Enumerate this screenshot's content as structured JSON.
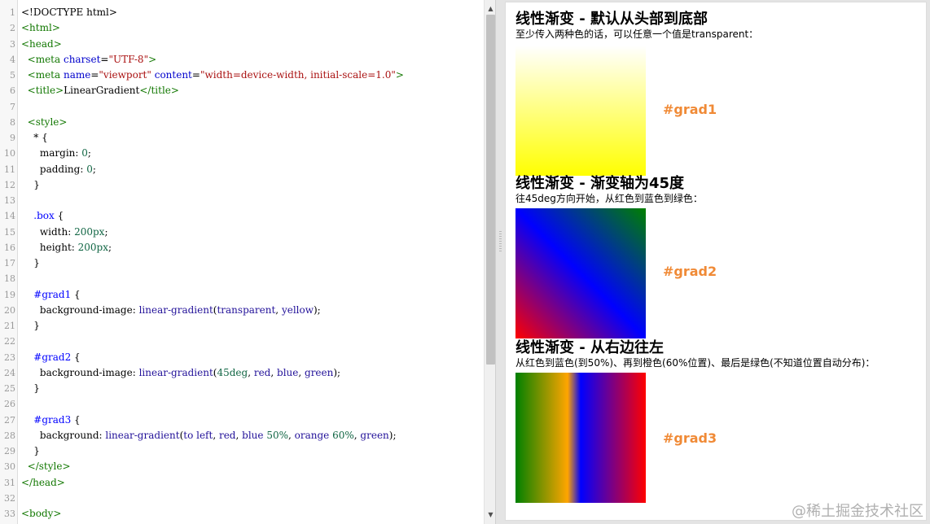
{
  "editor": {
    "lines": [
      [
        [
          "",
          "<!DOCTYPE html>"
        ]
      ],
      [
        [
          "tag",
          "<html>"
        ]
      ],
      [
        [
          "tag",
          "<head>"
        ]
      ],
      [
        [
          "",
          "  "
        ],
        [
          "tag",
          "<meta "
        ],
        [
          "attr",
          "charset"
        ],
        [
          "",
          "="
        ],
        [
          "str",
          "\"UTF-8\""
        ],
        [
          "tag",
          ">"
        ]
      ],
      [
        [
          "",
          "  "
        ],
        [
          "tag",
          "<meta "
        ],
        [
          "attr",
          "name"
        ],
        [
          "",
          "="
        ],
        [
          "str",
          "\"viewport\""
        ],
        [
          "",
          " "
        ],
        [
          "attr",
          "content"
        ],
        [
          "",
          "="
        ],
        [
          "str",
          "\"width=device-width, initial-scale=1.0\""
        ],
        [
          "tag",
          ">"
        ]
      ],
      [
        [
          "",
          "  "
        ],
        [
          "tag",
          "<title>"
        ],
        [
          "",
          "LinearGradient"
        ],
        [
          "tag",
          "</title>"
        ]
      ],
      [
        [
          "",
          ""
        ]
      ],
      [
        [
          "",
          "  "
        ],
        [
          "tag",
          "<style>"
        ]
      ],
      [
        [
          "",
          "    * {"
        ]
      ],
      [
        [
          "",
          "      "
        ],
        [
          "prop",
          "margin"
        ],
        [
          "",
          ": "
        ],
        [
          "num",
          "0"
        ],
        [
          "",
          ";"
        ]
      ],
      [
        [
          "",
          "      "
        ],
        [
          "prop",
          "padding"
        ],
        [
          "",
          ": "
        ],
        [
          "num",
          "0"
        ],
        [
          "",
          ";"
        ]
      ],
      [
        [
          "",
          "    }"
        ]
      ],
      [
        [
          "",
          ""
        ]
      ],
      [
        [
          "",
          "    "
        ],
        [
          "sel",
          ".box"
        ],
        [
          "",
          " {"
        ]
      ],
      [
        [
          "",
          "      "
        ],
        [
          "prop",
          "width"
        ],
        [
          "",
          ": "
        ],
        [
          "num",
          "200px"
        ],
        [
          "",
          ";"
        ]
      ],
      [
        [
          "",
          "      "
        ],
        [
          "prop",
          "height"
        ],
        [
          "",
          ": "
        ],
        [
          "num",
          "200px"
        ],
        [
          "",
          ";"
        ]
      ],
      [
        [
          "",
          "    }"
        ]
      ],
      [
        [
          "",
          ""
        ]
      ],
      [
        [
          "",
          "    "
        ],
        [
          "sel",
          "#grad1"
        ],
        [
          "",
          " {"
        ]
      ],
      [
        [
          "",
          "      "
        ],
        [
          "prop",
          "background-image"
        ],
        [
          "",
          ": "
        ],
        [
          "val",
          "linear-gradient"
        ],
        [
          "",
          "("
        ],
        [
          "val",
          "transparent"
        ],
        [
          "",
          ", "
        ],
        [
          "val",
          "yellow"
        ],
        [
          "",
          ");"
        ]
      ],
      [
        [
          "",
          "    }"
        ]
      ],
      [
        [
          "",
          ""
        ]
      ],
      [
        [
          "",
          "    "
        ],
        [
          "sel",
          "#grad2"
        ],
        [
          "",
          " {"
        ]
      ],
      [
        [
          "",
          "      "
        ],
        [
          "prop",
          "background-image"
        ],
        [
          "",
          ": "
        ],
        [
          "val",
          "linear-gradient"
        ],
        [
          "",
          "("
        ],
        [
          "num",
          "45deg"
        ],
        [
          "",
          ", "
        ],
        [
          "val",
          "red"
        ],
        [
          "",
          ", "
        ],
        [
          "val",
          "blue"
        ],
        [
          "",
          ", "
        ],
        [
          "val",
          "green"
        ],
        [
          "",
          ");"
        ]
      ],
      [
        [
          "",
          "    }"
        ]
      ],
      [
        [
          "",
          ""
        ]
      ],
      [
        [
          "",
          "    "
        ],
        [
          "sel",
          "#grad3"
        ],
        [
          "",
          " {"
        ]
      ],
      [
        [
          "",
          "      "
        ],
        [
          "prop",
          "background"
        ],
        [
          "",
          ": "
        ],
        [
          "val",
          "linear-gradient"
        ],
        [
          "",
          "("
        ],
        [
          "val",
          "to left"
        ],
        [
          "",
          ", "
        ],
        [
          "val",
          "red"
        ],
        [
          "",
          ", "
        ],
        [
          "val",
          "blue"
        ],
        [
          "",
          " "
        ],
        [
          "num",
          "50%"
        ],
        [
          "",
          ", "
        ],
        [
          "val",
          "orange"
        ],
        [
          "",
          " "
        ],
        [
          "num",
          "60%"
        ],
        [
          "",
          ", "
        ],
        [
          "val",
          "green"
        ],
        [
          "",
          ");"
        ]
      ],
      [
        [
          "",
          "    }"
        ]
      ],
      [
        [
          "",
          "  "
        ],
        [
          "tag",
          "</style>"
        ]
      ],
      [
        [
          "tag",
          "</head>"
        ]
      ],
      [
        [
          "",
          ""
        ]
      ],
      [
        [
          "tag",
          "<body>"
        ]
      ]
    ]
  },
  "icons": {
    "scroll_up": "scroll-up-arrow-icon",
    "scroll_down": "scroll-down-arrow-icon",
    "up_glyph": "▲",
    "down_glyph": "▼"
  },
  "preview": {
    "sections": [
      {
        "title": "线性渐变 - 默认从头部到底部",
        "desc": "至少传入两种色的话，可以任意一个值是transparent：",
        "label": "#grad1"
      },
      {
        "title": "线性渐变 - 渐变轴为45度",
        "desc": "往45deg方向开始，从红色到蓝色到绿色：",
        "label": "#grad2"
      },
      {
        "title": "线性渐变 - 从右边往左",
        "desc": "从红色到蓝色(到50%)、再到橙色(60%位置)、最后是绿色(不知道位置自动分布)：",
        "label": "#grad3"
      }
    ],
    "label_color": "#f08a36"
  },
  "watermark": "@稀土掘金技术社区"
}
